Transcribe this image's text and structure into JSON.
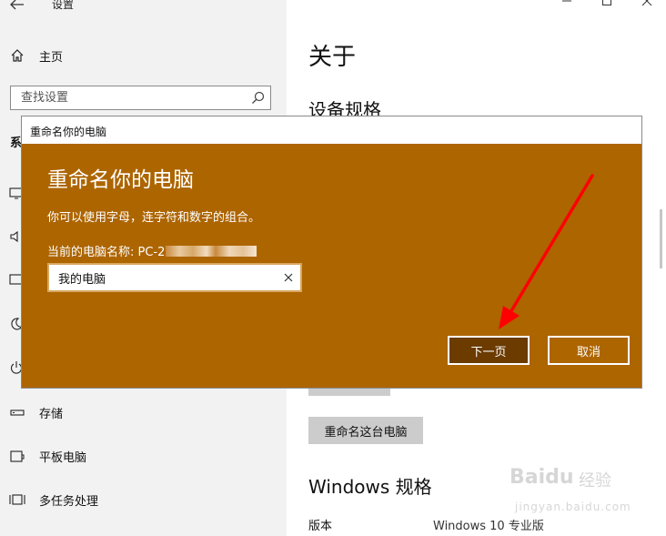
{
  "app": {
    "title": "设置",
    "window_controls": [
      "minimize",
      "maximize",
      "close"
    ]
  },
  "sidebar": {
    "home_label": "主页",
    "search_placeholder": "查找设置",
    "section_partial": "系",
    "items": [
      {
        "label": "存储",
        "icon": "storage-icon"
      },
      {
        "label": "平板电脑",
        "icon": "tablet-icon"
      },
      {
        "label": "多任务处理",
        "icon": "multitasking-icon"
      }
    ]
  },
  "main": {
    "page_title": "关于",
    "device_spec_heading": "设备规格",
    "rename_button": "重命名这台电脑",
    "windows_spec_heading": "Windows 规格",
    "edition_label": "版本",
    "edition_value": "Windows 10 专业版"
  },
  "dialog": {
    "titlebar": "重命名你的电脑",
    "heading": "重命名你的电脑",
    "description": "你可以使用字母，连字符和数字的组合。",
    "current_name_label": "当前的电脑名称: PC-2",
    "input_value": "我的电脑",
    "next_label": "下一页",
    "cancel_label": "取消",
    "accent_color": "#ad6500"
  },
  "annotation": {
    "arrow_color": "#ff0000"
  },
  "watermark": {
    "brand": "Bai",
    "brand_suffix": "经验",
    "url": "jingyan.baidu.com"
  }
}
